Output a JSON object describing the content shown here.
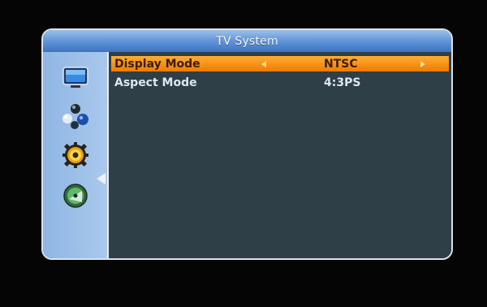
{
  "window": {
    "title": "TV System"
  },
  "sidebar": {
    "items": [
      {
        "icon": "tv-icon"
      },
      {
        "icon": "channels-icon"
      },
      {
        "icon": "settings-gear-icon",
        "active": true
      },
      {
        "icon": "satellite-dish-icon"
      }
    ]
  },
  "settings": {
    "rows": [
      {
        "label": "Display Mode",
        "value": "NTSC",
        "selected": true
      },
      {
        "label": "Aspect Mode",
        "value": "4:3PS",
        "selected": false
      }
    ]
  },
  "colors": {
    "title_bar": "#5c90d6",
    "sidebar": "#9dbfe8",
    "content_bg": "#2f3f48",
    "highlight": "#f58a12"
  }
}
